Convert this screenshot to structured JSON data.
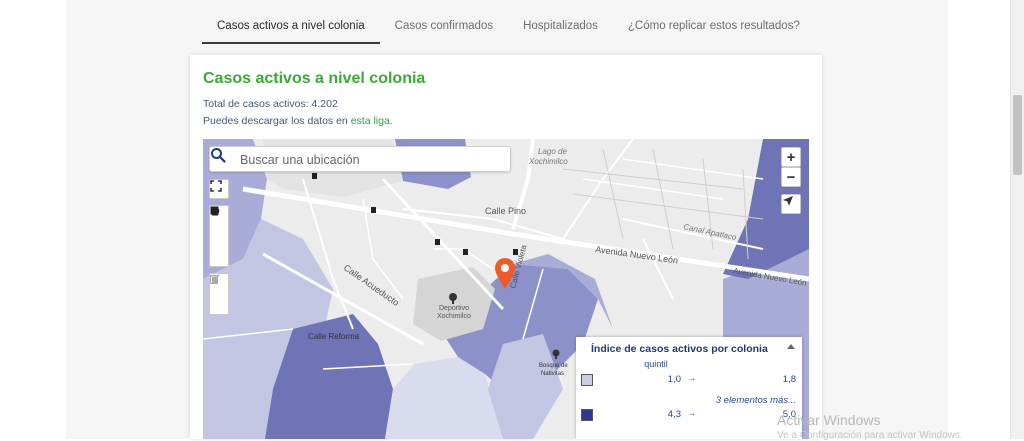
{
  "tabs": [
    {
      "label": "Casos activos a nivel colonia"
    },
    {
      "label": "Casos confirmados"
    },
    {
      "label": "Hospitalizados"
    },
    {
      "label": "¿Cómo replicar estos resultados?"
    }
  ],
  "card": {
    "title": "Casos activos a nivel colonia",
    "total_text": "Total de casos activos: 4.202",
    "download_prefix": "Puedes descargar los datos en ",
    "download_link": "esta liga",
    "download_suffix": "."
  },
  "map": {
    "search_placeholder": "Buscar una ubicación",
    "zoom_in": "+",
    "zoom_out": "−",
    "street_labels": {
      "lago": "Lago de",
      "xochimilco_lake": "Xochimilco",
      "pino": "Calle Pino",
      "nuevo_leon": "Avenida Nuevo León",
      "apatlaco": "Canal Apatlaco",
      "acueducto": "Calle Acueducto",
      "violeta": "Calle Violeta",
      "deportivo": "Deportivo",
      "deportivo2": "Xochimilco",
      "reforma": "Calle Reforma",
      "bosque": "Bosque de",
      "bosque2": "Nativitas",
      "avenida_colonia": "Avenida Nuevo León"
    },
    "colors": {
      "q1": "#cbcde6",
      "q2": "#a9acd6",
      "q3": "#8d91c9",
      "q4": "#6f74b6",
      "q5": "#313695",
      "marker": "#f05a28"
    }
  },
  "legend": {
    "title": "Índice de casos activos por colonia",
    "subtitle": "quintil",
    "row1": {
      "low": "1,0",
      "arrow": "→",
      "high": "1,8"
    },
    "more": "3 elementos más...",
    "row2": {
      "low": "4,3",
      "arrow": "→",
      "high": "5,0"
    }
  },
  "watermark": {
    "line1": "Activar Windows",
    "line2": "Ve a Configuración para activar Windows."
  }
}
